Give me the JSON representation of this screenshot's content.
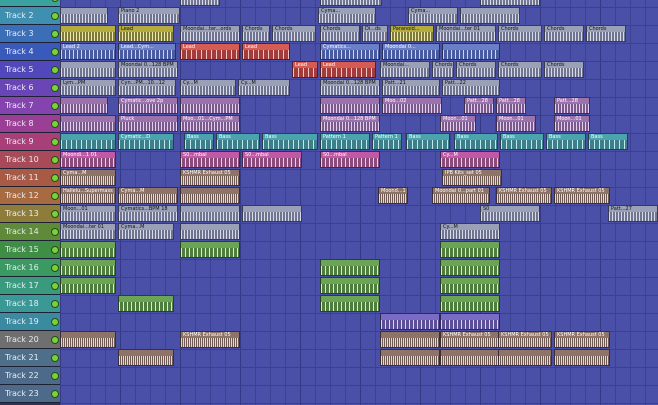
{
  "colors": {
    "playlist_bg": "#4a4fa8",
    "track_header_colors": [
      "#3aa3a0",
      "#3f8fb0",
      "#3a6fb8",
      "#3a5abb",
      "#5048bb",
      "#6a45b6",
      "#8543b0",
      "#9a3f95",
      "#a83f78",
      "#a84a58",
      "#a85a45",
      "#a86a40",
      "#8e7d3a",
      "#5e8a3a",
      "#3e8f45",
      "#3a9a62",
      "#3a9a7e",
      "#3a9896",
      "#3a8aa0",
      "#6f6f6f",
      "#4e6f8a",
      "#4e6a8a",
      "#4e6a8a"
    ]
  },
  "tracks": [
    {
      "name": ""
    },
    {
      "name": "Track 2"
    },
    {
      "name": "Track 3"
    },
    {
      "name": "Track 4"
    },
    {
      "name": "Track 5"
    },
    {
      "name": "Track 6"
    },
    {
      "name": "Track 7"
    },
    {
      "name": "Track 8"
    },
    {
      "name": "Track 9"
    },
    {
      "name": "Track 10"
    },
    {
      "name": "Track 11"
    },
    {
      "name": "Track 12"
    },
    {
      "name": "Track 13"
    },
    {
      "name": "Track 14"
    },
    {
      "name": "Track 15"
    },
    {
      "name": "Track 16"
    },
    {
      "name": "Track 17"
    },
    {
      "name": "Track 18"
    },
    {
      "name": "Track 19"
    },
    {
      "name": "Track 20"
    },
    {
      "name": "Track 21"
    },
    {
      "name": "Track 22"
    },
    {
      "name": "Track 23"
    }
  ],
  "clips": [
    {
      "track": 0,
      "start": 120,
      "len": 40,
      "label": "",
      "color": "grey"
    },
    {
      "track": 0,
      "start": 260,
      "len": 62,
      "label": "",
      "color": "grey"
    },
    {
      "track": 0,
      "start": 420,
      "len": 60,
      "label": "",
      "color": "grey"
    },
    {
      "track": 1,
      "start": 0,
      "len": 48,
      "label": "",
      "color": "grey"
    },
    {
      "track": 1,
      "start": 58,
      "len": 62,
      "label": "Piano 2",
      "color": "grey"
    },
    {
      "track": 1,
      "start": 258,
      "len": 58,
      "label": "Cyma...",
      "color": "grey"
    },
    {
      "track": 1,
      "start": 348,
      "len": 50,
      "label": "Cyma...",
      "color": "grey"
    },
    {
      "track": 1,
      "start": 400,
      "len": 60,
      "label": "",
      "color": "grey"
    },
    {
      "track": 2,
      "start": 0,
      "len": 56,
      "label": "",
      "color": "olive"
    },
    {
      "track": 2,
      "start": 58,
      "len": 56,
      "label": "Lead",
      "color": "olive"
    },
    {
      "track": 2,
      "start": 120,
      "len": 60,
      "label": "Moondai...ter...ords",
      "color": "grey"
    },
    {
      "track": 2,
      "start": 182,
      "len": 28,
      "label": "Chords",
      "color": "grey"
    },
    {
      "track": 2,
      "start": 212,
      "len": 44,
      "label": "Chords",
      "color": "grey"
    },
    {
      "track": 2,
      "start": 260,
      "len": 40,
      "label": "Chords",
      "color": "grey"
    },
    {
      "track": 2,
      "start": 302,
      "len": 26,
      "label": "Di...ds",
      "color": "grey"
    },
    {
      "track": 2,
      "start": 330,
      "len": 44,
      "label": "Paranoid...",
      "color": "olive"
    },
    {
      "track": 2,
      "start": 376,
      "len": 60,
      "label": "Moondai...ter 01",
      "color": "grey"
    },
    {
      "track": 2,
      "start": 438,
      "len": 44,
      "label": "Chords",
      "color": "grey"
    },
    {
      "track": 2,
      "start": 484,
      "len": 40,
      "label": "Chords",
      "color": "grey"
    },
    {
      "track": 2,
      "start": 526,
      "len": 40,
      "label": "Chords",
      "color": "grey"
    },
    {
      "track": 3,
      "start": 0,
      "len": 56,
      "label": "Lead 2",
      "color": "blue"
    },
    {
      "track": 3,
      "start": 58,
      "len": 58,
      "label": "Lead...Cym...",
      "color": "blue"
    },
    {
      "track": 3,
      "start": 120,
      "len": 60,
      "label": "Lead",
      "color": "red"
    },
    {
      "track": 3,
      "start": 182,
      "len": 48,
      "label": "Lead",
      "color": "red"
    },
    {
      "track": 3,
      "start": 260,
      "len": 60,
      "label": "Cymatics...",
      "color": "blue"
    },
    {
      "track": 3,
      "start": 322,
      "len": 58,
      "label": "Moondai 0...",
      "color": "blue"
    },
    {
      "track": 3,
      "start": 382,
      "len": 58,
      "label": "",
      "color": "blue"
    },
    {
      "track": 4,
      "start": 0,
      "len": 56,
      "label": "",
      "color": "grey"
    },
    {
      "track": 4,
      "start": 58,
      "len": 60,
      "label": "Moondai 0...128 BPM",
      "color": "grey"
    },
    {
      "track": 4,
      "start": 232,
      "len": 26,
      "label": "Lead",
      "color": "red"
    },
    {
      "track": 4,
      "start": 260,
      "len": 56,
      "label": "Lead",
      "color": "red"
    },
    {
      "track": 4,
      "start": 320,
      "len": 50,
      "label": "Moondai...",
      "color": "grey"
    },
    {
      "track": 4,
      "start": 372,
      "len": 22,
      "label": "Chords",
      "color": "grey"
    },
    {
      "track": 4,
      "start": 396,
      "len": 40,
      "label": "Chords",
      "color": "grey"
    },
    {
      "track": 4,
      "start": 438,
      "len": 44,
      "label": "Chords",
      "color": "grey"
    },
    {
      "track": 4,
      "start": 484,
      "len": 40,
      "label": "Chords",
      "color": "grey"
    },
    {
      "track": 5,
      "start": 0,
      "len": 56,
      "label": "Lym...PM",
      "color": "grey"
    },
    {
      "track": 5,
      "start": 58,
      "len": 58,
      "label": "Cyn...PM...10...12",
      "color": "grey"
    },
    {
      "track": 5,
      "start": 120,
      "len": 56,
      "label": "Cy...M",
      "color": "grey"
    },
    {
      "track": 5,
      "start": 178,
      "len": 52,
      "label": "Cy...M",
      "color": "grey"
    },
    {
      "track": 5,
      "start": 260,
      "len": 60,
      "label": "Moondai 0...128 BPM",
      "color": "grey"
    },
    {
      "track": 5,
      "start": 322,
      "len": 58,
      "label": "Patt...21",
      "color": "grey"
    },
    {
      "track": 5,
      "start": 382,
      "len": 58,
      "label": "Patt...22",
      "color": "grey"
    },
    {
      "track": 6,
      "start": 0,
      "len": 48,
      "label": "",
      "color": "mauve"
    },
    {
      "track": 6,
      "start": 58,
      "len": 60,
      "label": "Cymatic...ove 2p",
      "color": "mauve"
    },
    {
      "track": 6,
      "start": 120,
      "len": 60,
      "label": "",
      "color": "mauve"
    },
    {
      "track": 6,
      "start": 260,
      "len": 60,
      "label": "",
      "color": "mauve"
    },
    {
      "track": 6,
      "start": 322,
      "len": 60,
      "label": "Moo...02",
      "color": "mauve"
    },
    {
      "track": 6,
      "start": 404,
      "len": 30,
      "label": "Patt...28",
      "color": "mauve"
    },
    {
      "track": 6,
      "start": 436,
      "len": 30,
      "label": "Patt...28",
      "color": "mauve"
    },
    {
      "track": 6,
      "start": 494,
      "len": 36,
      "label": "Patt...28",
      "color": "mauve"
    },
    {
      "track": 7,
      "start": 0,
      "len": 56,
      "label": "",
      "color": "mauve"
    },
    {
      "track": 7,
      "start": 58,
      "len": 60,
      "label": "Pluck",
      "color": "mauve"
    },
    {
      "track": 7,
      "start": 120,
      "len": 60,
      "label": "Moo...01...Cym...PM",
      "color": "mauve"
    },
    {
      "track": 7,
      "start": 260,
      "len": 60,
      "label": "Moondai 0...128 BPM",
      "color": "mauve"
    },
    {
      "track": 7,
      "start": 380,
      "len": 36,
      "label": "Moon...01",
      "color": "mauve"
    },
    {
      "track": 7,
      "start": 436,
      "len": 40,
      "label": "Moon...01",
      "color": "mauve"
    },
    {
      "track": 7,
      "start": 494,
      "len": 36,
      "label": "Moon...01",
      "color": "mauve"
    },
    {
      "track": 8,
      "start": 0,
      "len": 56,
      "label": "",
      "color": "teal"
    },
    {
      "track": 8,
      "start": 58,
      "len": 56,
      "label": "Cymatic...D",
      "color": "teal"
    },
    {
      "track": 8,
      "start": 124,
      "len": 30,
      "label": "Bass",
      "color": "teal"
    },
    {
      "track": 8,
      "start": 156,
      "len": 44,
      "label": "Bass",
      "color": "teal"
    },
    {
      "track": 8,
      "start": 202,
      "len": 56,
      "label": "Bass",
      "color": "teal"
    },
    {
      "track": 8,
      "start": 260,
      "len": 50,
      "label": "Pattern 1",
      "color": "teal"
    },
    {
      "track": 8,
      "start": 312,
      "len": 30,
      "label": "Pattern 1",
      "color": "teal"
    },
    {
      "track": 8,
      "start": 346,
      "len": 44,
      "label": "Bass",
      "color": "teal"
    },
    {
      "track": 8,
      "start": 394,
      "len": 44,
      "label": "Bass",
      "color": "teal"
    },
    {
      "track": 8,
      "start": 440,
      "len": 44,
      "label": "Bass",
      "color": "teal"
    },
    {
      "track": 8,
      "start": 486,
      "len": 40,
      "label": "Bass",
      "color": "teal"
    },
    {
      "track": 8,
      "start": 528,
      "len": 40,
      "label": "Bass",
      "color": "teal"
    },
    {
      "track": 9,
      "start": 0,
      "len": 56,
      "label": "Moondi...1 01",
      "color": "pink"
    },
    {
      "track": 9,
      "start": 120,
      "len": 60,
      "label": "S0...mbal",
      "color": "pink"
    },
    {
      "track": 9,
      "start": 182,
      "len": 60,
      "label": "S0...mbal",
      "color": "pink"
    },
    {
      "track": 9,
      "start": 260,
      "len": 60,
      "label": "S0...mbal",
      "color": "pink"
    },
    {
      "track": 9,
      "start": 380,
      "len": 60,
      "label": "Cy...M",
      "color": "pink"
    },
    {
      "track": 10,
      "start": 0,
      "len": 56,
      "label": "Cyma...M",
      "color": "brown"
    },
    {
      "track": 10,
      "start": 120,
      "len": 60,
      "label": "KSHMR Exhaust 05",
      "color": "brown"
    },
    {
      "track": 10,
      "start": 382,
      "len": 60,
      "label": "IPB Kits_set 05",
      "color": "brown"
    },
    {
      "track": 11,
      "start": 0,
      "len": 56,
      "label": "Hallelu...Supermass",
      "color": "brown"
    },
    {
      "track": 11,
      "start": 58,
      "len": 60,
      "label": "Cyma...M",
      "color": "brown"
    },
    {
      "track": 11,
      "start": 120,
      "len": 60,
      "label": "",
      "color": "brown"
    },
    {
      "track": 11,
      "start": 318,
      "len": 30,
      "label": "Moond...1 01",
      "color": "brown"
    },
    {
      "track": 11,
      "start": 372,
      "len": 58,
      "label": "Moondai 0...part 01",
      "color": "brown"
    },
    {
      "track": 11,
      "start": 436,
      "len": 56,
      "label": "KSHMR Exhaust 05",
      "color": "brown"
    },
    {
      "track": 11,
      "start": 494,
      "len": 56,
      "label": "KSHMR Exhaust 05",
      "color": "brown"
    },
    {
      "track": 12,
      "start": 0,
      "len": 56,
      "label": "Moon...01",
      "color": "grey"
    },
    {
      "track": 12,
      "start": 58,
      "len": 60,
      "label": "Cymatics...BPM 18",
      "color": "grey"
    },
    {
      "track": 12,
      "start": 120,
      "len": 60,
      "label": "",
      "color": "grey"
    },
    {
      "track": 12,
      "start": 182,
      "len": 60,
      "label": "",
      "color": "grey"
    },
    {
      "track": 12,
      "start": 420,
      "len": 60,
      "label": "S0",
      "color": "grey"
    },
    {
      "track": 12,
      "start": 548,
      "len": 50,
      "label": "Patt...27",
      "color": "grey"
    },
    {
      "track": 13,
      "start": 0,
      "len": 56,
      "label": "Moondai...ter 01",
      "color": "grey"
    },
    {
      "track": 13,
      "start": 58,
      "len": 56,
      "label": "Cyma...M",
      "color": "grey"
    },
    {
      "track": 13,
      "start": 120,
      "len": 60,
      "label": "",
      "color": "grey"
    },
    {
      "track": 13,
      "start": 380,
      "len": 60,
      "label": "Cy...M",
      "color": "grey"
    },
    {
      "track": 14,
      "start": 0,
      "len": 56,
      "label": "",
      "color": "green"
    },
    {
      "track": 14,
      "start": 120,
      "len": 60,
      "label": "",
      "color": "green"
    },
    {
      "track": 14,
      "start": 380,
      "len": 60,
      "label": "",
      "color": "green"
    },
    {
      "track": 15,
      "start": 0,
      "len": 56,
      "label": "",
      "color": "green"
    },
    {
      "track": 15,
      "start": 260,
      "len": 60,
      "label": "",
      "color": "green"
    },
    {
      "track": 15,
      "start": 380,
      "len": 60,
      "label": "",
      "color": "green"
    },
    {
      "track": 16,
      "start": 0,
      "len": 56,
      "label": "",
      "color": "green"
    },
    {
      "track": 16,
      "start": 260,
      "len": 60,
      "label": "",
      "color": "green"
    },
    {
      "track": 16,
      "start": 380,
      "len": 60,
      "label": "",
      "color": "green"
    },
    {
      "track": 17,
      "start": 58,
      "len": 56,
      "label": "",
      "color": "green"
    },
    {
      "track": 17,
      "start": 260,
      "len": 60,
      "label": "",
      "color": "green"
    },
    {
      "track": 17,
      "start": 380,
      "len": 60,
      "label": "",
      "color": "green"
    },
    {
      "track": 18,
      "start": 320,
      "len": 60,
      "label": "",
      "color": "purple"
    },
    {
      "track": 18,
      "start": 380,
      "len": 60,
      "label": "",
      "color": "purple"
    },
    {
      "track": 19,
      "start": 0,
      "len": 56,
      "label": "",
      "color": "brown"
    },
    {
      "track": 19,
      "start": 120,
      "len": 60,
      "label": "KSHMR Exhaust 05",
      "color": "brown"
    },
    {
      "track": 19,
      "start": 320,
      "len": 60,
      "label": "",
      "color": "brown"
    },
    {
      "track": 19,
      "start": 380,
      "len": 60,
      "label": "KSHMR Exhaust 05",
      "color": "brown"
    },
    {
      "track": 19,
      "start": 438,
      "len": 54,
      "label": "KSHMR Exhaust 05",
      "color": "brown"
    },
    {
      "track": 19,
      "start": 494,
      "len": 56,
      "label": "KSHMR Exhaust 05",
      "color": "brown"
    },
    {
      "track": 20,
      "start": 58,
      "len": 56,
      "label": "",
      "color": "brown"
    },
    {
      "track": 20,
      "start": 320,
      "len": 60,
      "label": "",
      "color": "brown"
    },
    {
      "track": 20,
      "start": 380,
      "len": 60,
      "label": "",
      "color": "brown"
    },
    {
      "track": 20,
      "start": 438,
      "len": 54,
      "label": "",
      "color": "brown"
    },
    {
      "track": 20,
      "start": 494,
      "len": 56,
      "label": "",
      "color": "brown"
    }
  ]
}
